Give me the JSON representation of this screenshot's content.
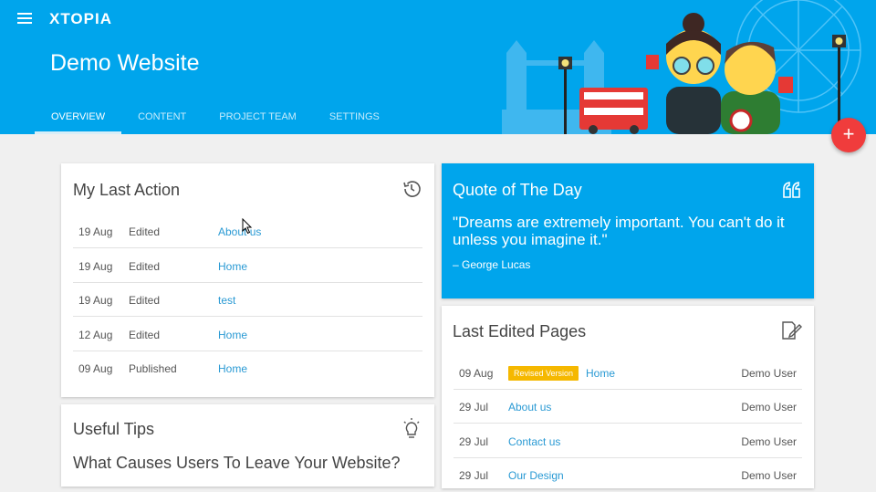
{
  "header": {
    "logo": "XTOPIA",
    "site_title": "Demo Website",
    "tabs": [
      {
        "label": "OVERVIEW",
        "active": true
      },
      {
        "label": "CONTENT",
        "active": false
      },
      {
        "label": "PROJECT TEAM",
        "active": false
      },
      {
        "label": "SETTINGS",
        "active": false
      }
    ],
    "fab_label": "+"
  },
  "last_action": {
    "title": "My Last Action",
    "rows": [
      {
        "date": "19 Aug",
        "action": "Edited",
        "page": "About us"
      },
      {
        "date": "19 Aug",
        "action": "Edited",
        "page": "Home"
      },
      {
        "date": "19 Aug",
        "action": "Edited",
        "page": "test"
      },
      {
        "date": "12 Aug",
        "action": "Edited",
        "page": "Home"
      },
      {
        "date": "09 Aug",
        "action": "Published",
        "page": "Home"
      }
    ]
  },
  "quote": {
    "title": "Quote of The Day",
    "text": "\"Dreams are extremely important. You can't do it unless you imagine it.\"",
    "author": "– George Lucas"
  },
  "last_edited": {
    "title": "Last Edited Pages",
    "rows": [
      {
        "date": "09 Aug",
        "badge": "Revised Version",
        "page": "Home",
        "user": "Demo User"
      },
      {
        "date": "29 Jul",
        "badge": "",
        "page": "About us",
        "user": "Demo User"
      },
      {
        "date": "29 Jul",
        "badge": "",
        "page": "Contact us",
        "user": "Demo User"
      },
      {
        "date": "29 Jul",
        "badge": "",
        "page": "Our Design",
        "user": "Demo User"
      }
    ]
  },
  "tips": {
    "title": "Useful Tips",
    "headline": "What Causes Users To Leave Your Website?"
  },
  "colors": {
    "header": "#00a5ec",
    "accent_link": "#2a9ad4",
    "fab": "#f03c3c",
    "badge": "#f5b800"
  }
}
